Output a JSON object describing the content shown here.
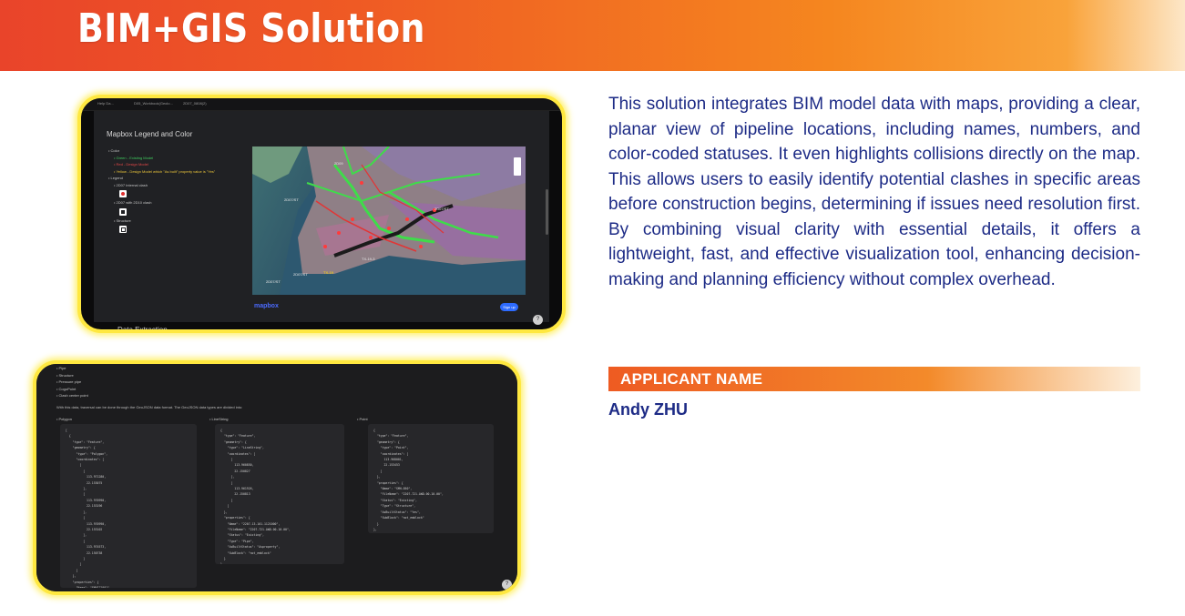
{
  "header": {
    "title": "BIM+GIS Solution"
  },
  "description": "This solution integrates BIM model data with maps, providing a clear, planar view of pipeline locations, including names, numbers, and color-coded statuses. It even highlights collisions directly on the map. This allows users to easily identify potential clashes in specific areas before construction begins, determining if issues need resolution first. By combining visual clarity with essential details, it offers a lightweight, fast, and effective visualization tool, enhancing decision-making and planning efficiency without complex overhead.",
  "applicant": {
    "heading": "APPLICANT NAME",
    "name": "Andy ZHU"
  },
  "screenshot1": {
    "tabs": [
      "Help Da...",
      "D05_Workbook(Geolo...",
      "2D07_0808(2)"
    ],
    "title": "Mapbox Legend and Color",
    "legend": {
      "color_label": "Color",
      "green": "Green - Existing Model",
      "red": "Red - Design Model",
      "yellow": "Yellow - Design Model which \"As built\" property value is \"Yes\"",
      "legend_label": "Legend",
      "internal_clash": "2D07 Internal clash",
      "with_2d10": "2D07 with 2D10 clash",
      "structure": "Structure"
    },
    "map_labels": [
      "2D07/ST",
      "2D09",
      "TX-19",
      "2D07/ST",
      "2D07/ST",
      "TX-19-3",
      "2D07/ST"
    ],
    "mapbox_logo": "mapbox",
    "signup": "Sign up",
    "bottom_heading": "Data Extraction",
    "help_icon": "?"
  },
  "screenshot2": {
    "list": [
      "Pipe",
      "Structure",
      "Pressure pipe",
      "CogoPoint",
      "Clash center point"
    ],
    "caption": "With this data, traversal can be done through the GeoJSON data format. The GeoJSON data types are divided into:",
    "columns": [
      "Polygon",
      "LineString",
      "Point"
    ],
    "code_polygon": "[\n  {\n    \"type\": \"Feature\",\n    \"geometry\": {\n      \"type\": \"Polygon\",\n      \"coordinates\": [\n        [\n          [\n            113.971280,\n            22.153075\n          ],\n          [\n            113.970990,\n            22.153196\n          ],\n          [\n            113.970990,\n            22.153102\n          ],\n          [\n            113.974573,\n            22.150738\n          ]\n        ]\n      ]\n    },\n    \"properties\": {\n      \"Name\": \"SMH122001\"",
    "code_linestring": "{\n  \"type\": \"Feature\",\n  \"geometry\": {\n    \"type\": \"LineString\",\n    \"coordinates\": [\n      [\n        113.960850,\n        22.150827\n      ],\n      [\n        113.961926,\n        22.150813\n      ]\n    ]\n  },\n  \"properties\": {\n    \"Name\": \"2207-13-101-1121000\",\n    \"FileName\": \"2207-721-AWD-00-10-00\",\n    \"Status\": \"Existing\",\n    \"Type\": \"Pipe\",\n    \"AsBuiltStatus\": \"Asproperty\",\n    \"SubBlock\": \"not_emblock\"\n  }\n},",
    "code_point": "{\n  \"type\": \"Feature\",\n  \"geometry\": {\n    \"type\": \"Point\",\n    \"coordinates\": [\n      113.968001,\n      22.153453\n    ]\n  },\n  \"properties\": {\n    \"Name\": \"SMH-050\",\n    \"FileName\": \"2207-721-AWD-00-10-00\",\n    \"Status\": \"Existing\",\n    \"Type\": \"Structure\",\n    \"AsBuiltStatus\": \"Yes\",\n    \"SubBlock\": \"not_emblock\"\n  }\n},",
    "help_icon": "?"
  },
  "colors": {
    "frame_glow": "#ffe840",
    "text_blue": "#1d2b86",
    "accent_orange": "#ef5a24"
  }
}
